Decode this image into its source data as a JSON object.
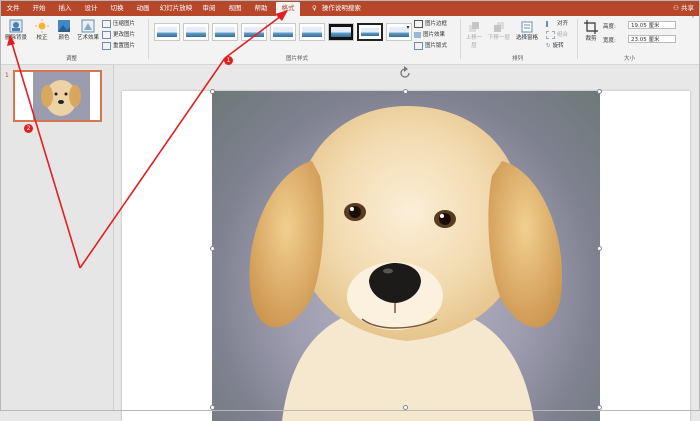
{
  "tabs": [
    "文件",
    "开始",
    "插入",
    "设计",
    "切换",
    "动画",
    "幻灯片放映",
    "审阅",
    "视图",
    "帮助",
    "格式"
  ],
  "search_label": "操作说明搜索",
  "share_label": "共享",
  "ribbon": {
    "remove_bg": "删除背景",
    "corrections": "校正",
    "color": "颜色",
    "artistic": "艺术效果",
    "compress": "压缩图片",
    "change_pic": "更改图片",
    "reset_pic": "重置图片",
    "adjust_group": "调整",
    "styles_group": "图片样式",
    "border": "图片边框",
    "effects": "图片效果",
    "layout": "图片版式",
    "bring_forward": "上移一层",
    "send_backward": "下移一层",
    "selection_pane": "选择窗格",
    "align": "对齐",
    "group": "组合",
    "rotate": "旋转",
    "arrange_group": "排列",
    "crop": "裁剪",
    "height_label": "高度:",
    "height_value": "19.05 厘米",
    "width_label": "宽度:",
    "width_value": "23.05 厘米",
    "size_group": "大小"
  },
  "slide_number": "1",
  "annotations": [
    "1",
    "2"
  ],
  "colors": {
    "accent": "#b7472a",
    "annotation": "#e02020",
    "thumb_border": "#d9744e"
  }
}
